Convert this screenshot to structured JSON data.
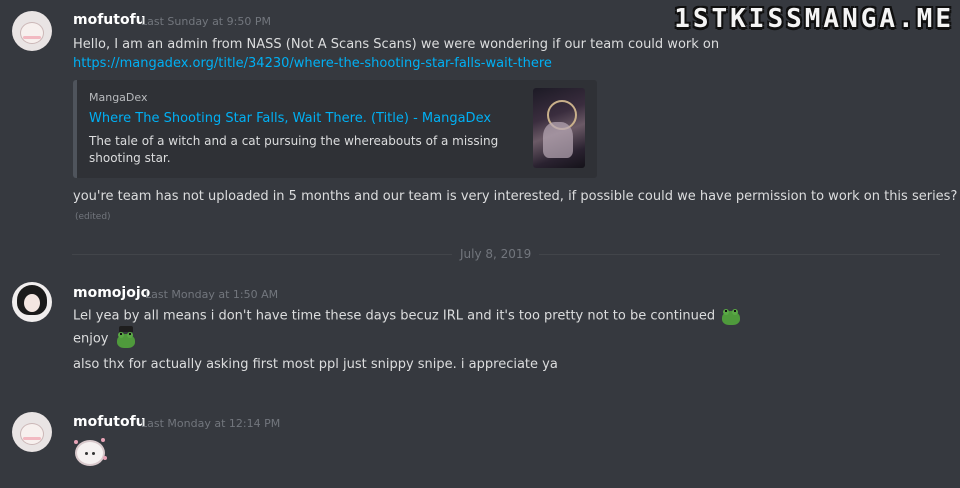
{
  "watermark": "1STKISSMANGA.ME",
  "messages": [
    {
      "username": "mofutofu",
      "timestamp": "Last Sunday at 9:50 PM",
      "line1": "Hello,  I am an admin from NASS (Not A Scans Scans) we were wondering if our team could work on",
      "link": "https://mangadex.org/title/34230/where-the-shooting-star-falls-wait-there",
      "embed": {
        "provider": "MangaDex",
        "title": "Where The Shooting Star Falls, Wait There. (Title) - MangaDex",
        "description": "The tale of a witch and a cat pursuing the whereabouts of a missing shooting star."
      },
      "line2": "you're team has not uploaded in 5 months and our team is very interested, if possible could we have permission to work on this series?",
      "edited": "(edited)"
    },
    {
      "username": "momojojo",
      "timestamp": "Last Monday at 1:50 AM",
      "line1": "Lel yea by all means i don't have time these days becuz IRL and it's too pretty not to be continued",
      "line2": "enjoy",
      "line3": "also thx for actually asking first most ppl just snippy snipe. i appreciate ya"
    },
    {
      "username": "mofutofu",
      "timestamp": "Last Monday at 12:14 PM"
    }
  ],
  "divider_date": "July 8, 2019",
  "icons": [
    "frog-emoji-icon",
    "frog-hat-emoji-icon",
    "sheep-emoji-icon"
  ],
  "colors": {
    "background": "#36393f",
    "link": "#00b0f4",
    "timestamp": "#72767d",
    "embed_bg": "#2f3136"
  }
}
